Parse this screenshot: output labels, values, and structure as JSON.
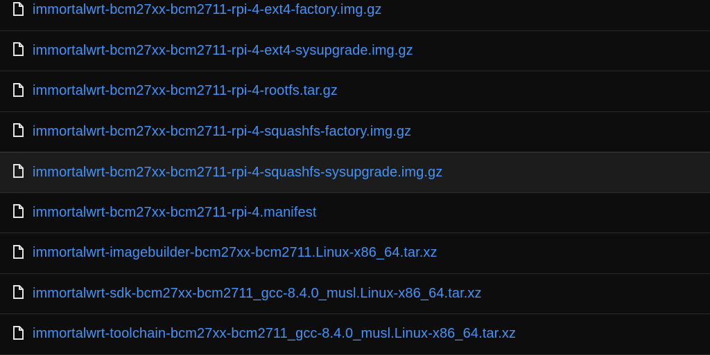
{
  "files": [
    {
      "name": "immortalwrt-bcm27xx-bcm2711-rpi-4-ext4-factory.img.gz",
      "icon": "file-icon"
    },
    {
      "name": "immortalwrt-bcm27xx-bcm2711-rpi-4-ext4-sysupgrade.img.gz",
      "icon": "file-icon"
    },
    {
      "name": "immortalwrt-bcm27xx-bcm2711-rpi-4-rootfs.tar.gz",
      "icon": "file-icon"
    },
    {
      "name": "immortalwrt-bcm27xx-bcm2711-rpi-4-squashfs-factory.img.gz",
      "icon": "file-icon"
    },
    {
      "name": "immortalwrt-bcm27xx-bcm2711-rpi-4-squashfs-sysupgrade.img.gz",
      "icon": "file-icon"
    },
    {
      "name": "immortalwrt-bcm27xx-bcm2711-rpi-4.manifest",
      "icon": "file-icon"
    },
    {
      "name": "immortalwrt-imagebuilder-bcm27xx-bcm2711.Linux-x86_64.tar.xz",
      "icon": "file-icon"
    },
    {
      "name": "immortalwrt-sdk-bcm27xx-bcm2711_gcc-8.4.0_musl.Linux-x86_64.tar.xz",
      "icon": "file-icon"
    },
    {
      "name": "immortalwrt-toolchain-bcm27xx-bcm2711_gcc-8.4.0_musl.Linux-x86_64.tar.xz",
      "icon": "file-icon"
    }
  ],
  "colors": {
    "background": "#0d0d0d",
    "link": "#4493f8",
    "divider": "#2a2a2a",
    "hover_row": "#1c1c1c",
    "icon": "#e6e6e6"
  }
}
